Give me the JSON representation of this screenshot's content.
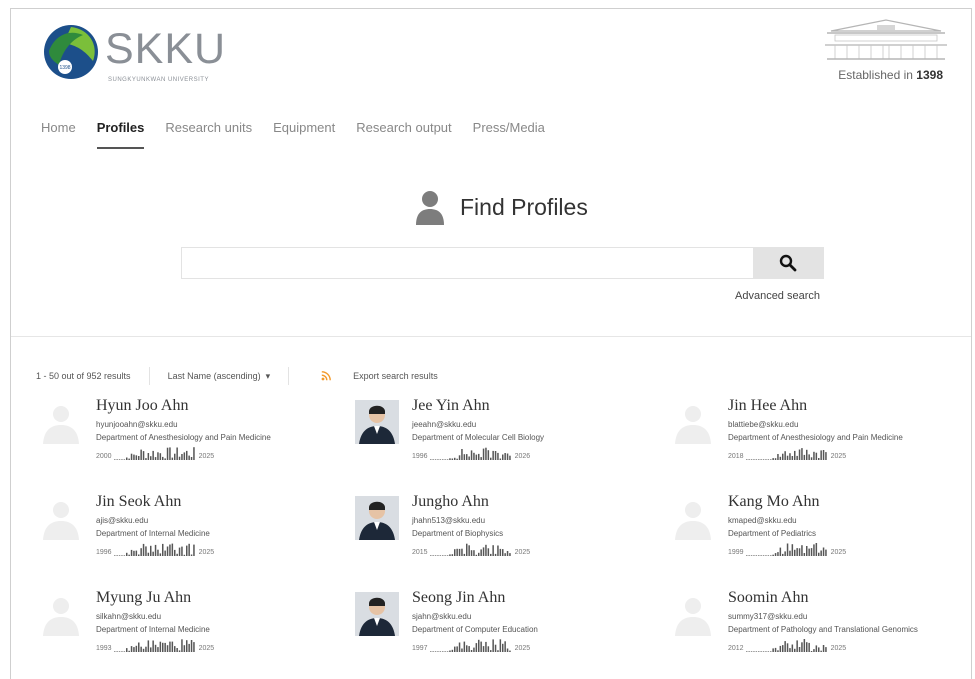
{
  "header": {
    "logo_text": "SKKU",
    "logo_subtext": "SUNGKYUNKWAN UNIVERSITY",
    "established_label": "Established in",
    "established_year": "1398"
  },
  "nav": {
    "items": [
      {
        "label": "Home",
        "active": false
      },
      {
        "label": "Profiles",
        "active": true
      },
      {
        "label": "Research units",
        "active": false
      },
      {
        "label": "Equipment",
        "active": false
      },
      {
        "label": "Research output",
        "active": false
      },
      {
        "label": "Press/Media",
        "active": false
      }
    ]
  },
  "search": {
    "title": "Find Profiles",
    "value": "",
    "placeholder": "",
    "advanced_label": "Advanced search"
  },
  "results": {
    "count_text": "1 - 50 out of 952 results",
    "sort_label": "Last Name (ascending)",
    "export_label": "Export search results"
  },
  "profiles": [
    {
      "name": "Hyun Joo Ahn",
      "email": "hyunjooahn@skku.edu",
      "dept": "Department of Anesthesiology and Pain Medicine",
      "start": "2000",
      "end": "2025",
      "has_photo": false
    },
    {
      "name": "Jee Yin Ahn",
      "email": "jeeahn@skku.edu",
      "dept": "Department of Molecular Cell Biology",
      "start": "1996",
      "end": "2026",
      "has_photo": true
    },
    {
      "name": "Jin Hee Ahn",
      "email": "blattiebe@skku.edu",
      "dept": "Department of Anesthesiology and Pain Medicine",
      "start": "2018",
      "end": "2025",
      "has_photo": false
    },
    {
      "name": "Jin Seok Ahn",
      "email": "ajis@skku.edu",
      "dept": "Department of Internal Medicine",
      "start": "1996",
      "end": "2025",
      "has_photo": false
    },
    {
      "name": "Jungho Ahn",
      "email": "jhahn513@skku.edu",
      "dept": "Department of Biophysics",
      "start": "2015",
      "end": "2025",
      "has_photo": true
    },
    {
      "name": "Kang Mo Ahn",
      "email": "kmaped@skku.edu",
      "dept": "Department of Pediatrics",
      "start": "1999",
      "end": "2025",
      "has_photo": false
    },
    {
      "name": "Myung Ju Ahn",
      "email": "silkahn@skku.edu",
      "dept": "Department of Internal Medicine",
      "start": "1993",
      "end": "2025",
      "has_photo": false
    },
    {
      "name": "Seong Jin Ahn",
      "email": "sjahn@skku.edu",
      "dept": "Department of Computer Education",
      "start": "1997",
      "end": "2025",
      "has_photo": true
    },
    {
      "name": "Soomin Ahn",
      "email": "summy317@skku.edu",
      "dept": "Department of Pathology and Translational Genomics",
      "start": "2012",
      "end": "2025",
      "has_photo": false
    }
  ],
  "colors": {
    "logo_green": "#2f8a3c",
    "logo_blue": "#1c4f8a",
    "logo_gray": "#8a8f96",
    "search_button": "#e3e3e3",
    "rss": "#f39a2b"
  },
  "icons": {
    "search": "magnifier-icon",
    "person": "person-icon",
    "rss": "rss-feed-icon"
  }
}
